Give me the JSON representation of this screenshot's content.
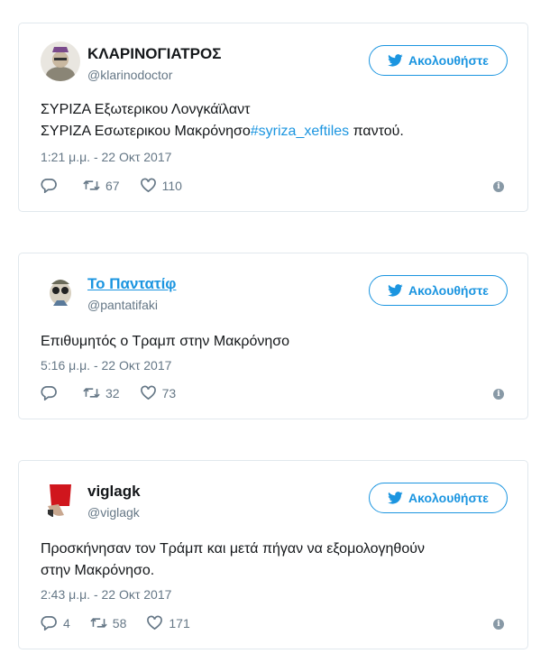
{
  "follow_label": "Ακολουθήστε",
  "accent_color": "#1b95e0",
  "tweets": [
    {
      "name": "ΚΛΑΡΙΝΟΓΙΑΤΡΟΣ",
      "handle": "@klarinodoctor",
      "text_line1": "ΣΥΡΙΖΑ Εξωτερικου Λονγκάϊλαντ",
      "text_line2_prefix": "ΣΥΡΙΖΑ Εσωτερικου Μακρόνησο",
      "hashtag": "#syriza_xeftiles",
      "text_line2_suffix": " παντού.",
      "time": "1:21 μ.μ. - 22 Οκτ 2017",
      "replies": "",
      "retweets": "67",
      "likes": "110"
    },
    {
      "name": "Το Παντατίφ",
      "handle": "@pantatifaki",
      "text_line1": "Επιθυμητός ο Τραμπ στην Μακρόνησο",
      "time": "5:16 μ.μ. - 22 Οκτ 2017",
      "replies": "",
      "retweets": "32",
      "likes": "73"
    },
    {
      "name": "viglagk",
      "handle": "@viglagk",
      "text_line1": "Προσκήνησαν τον Τράμπ και μετά πήγαν να εξομολογηθούν",
      "text_line2": "στην Μακρόνησο.",
      "time": "2:43 μ.μ. - 22 Οκτ 2017",
      "replies": "4",
      "retweets": "58",
      "likes": "171"
    }
  ]
}
